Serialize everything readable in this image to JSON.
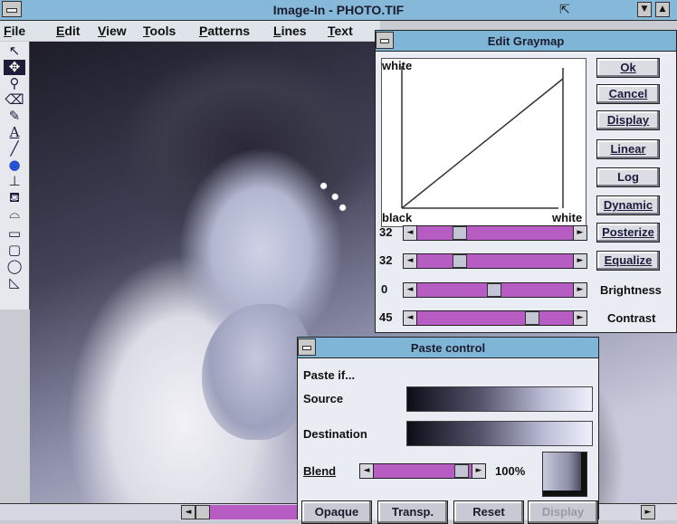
{
  "window": {
    "title": "Image-In - PHOTO.TIF",
    "menu": [
      "File",
      "Edit",
      "View",
      "Tools",
      "Patterns",
      "Lines",
      "Text"
    ]
  },
  "tools": [
    "arrow-icon",
    "move-icon",
    "zoom-icon",
    "eraser-icon",
    "pencil-icon",
    "text-icon",
    "line-icon",
    "fill-icon",
    "stamp-icon",
    "spray-icon",
    "lasso-icon",
    "rectangle-icon",
    "rounded-rect-icon",
    "ellipse-icon",
    "polygon-icon"
  ],
  "graymap": {
    "title": "Edit Graymap",
    "white_top": "white",
    "black": "black",
    "white_right": "white",
    "buttons": [
      "Ok",
      "Cancel",
      "Display",
      "Linear",
      "Log",
      "Dynamic",
      "Posterize",
      "Equalize"
    ],
    "sliders": [
      {
        "value": "32",
        "label": ""
      },
      {
        "value": "32",
        "label": ""
      },
      {
        "value": "0",
        "label": "Brightness"
      },
      {
        "value": "45",
        "label": "Contrast"
      }
    ]
  },
  "paste": {
    "title": "Paste control",
    "paste_if": "Paste if...",
    "source": "Source",
    "destination": "Destination",
    "blend": "Blend",
    "blend_value": "100%",
    "buttons": [
      "Opaque",
      "Transp.",
      "Reset",
      "Display"
    ]
  },
  "colors": {
    "titlebar": "#86b9d9",
    "slider_track": "#b75cc2",
    "dialog_bg": "#e9ecf2"
  }
}
